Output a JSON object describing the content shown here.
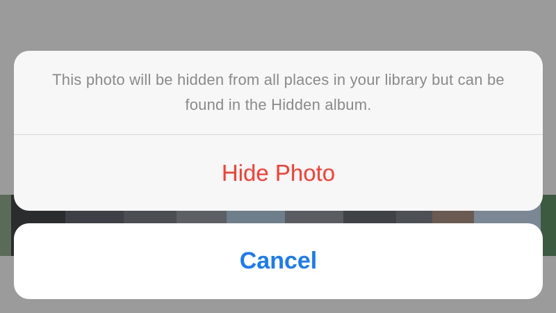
{
  "background": {
    "strip_thumbnails": 12
  },
  "action_sheet": {
    "message": "This photo will be hidden from all places in your library but can be found in the Hidden album.",
    "primary_action_label": "Hide Photo",
    "primary_action_color": "#ff3b30",
    "cancel_label": "Cancel",
    "cancel_color": "#1a7cf5"
  }
}
